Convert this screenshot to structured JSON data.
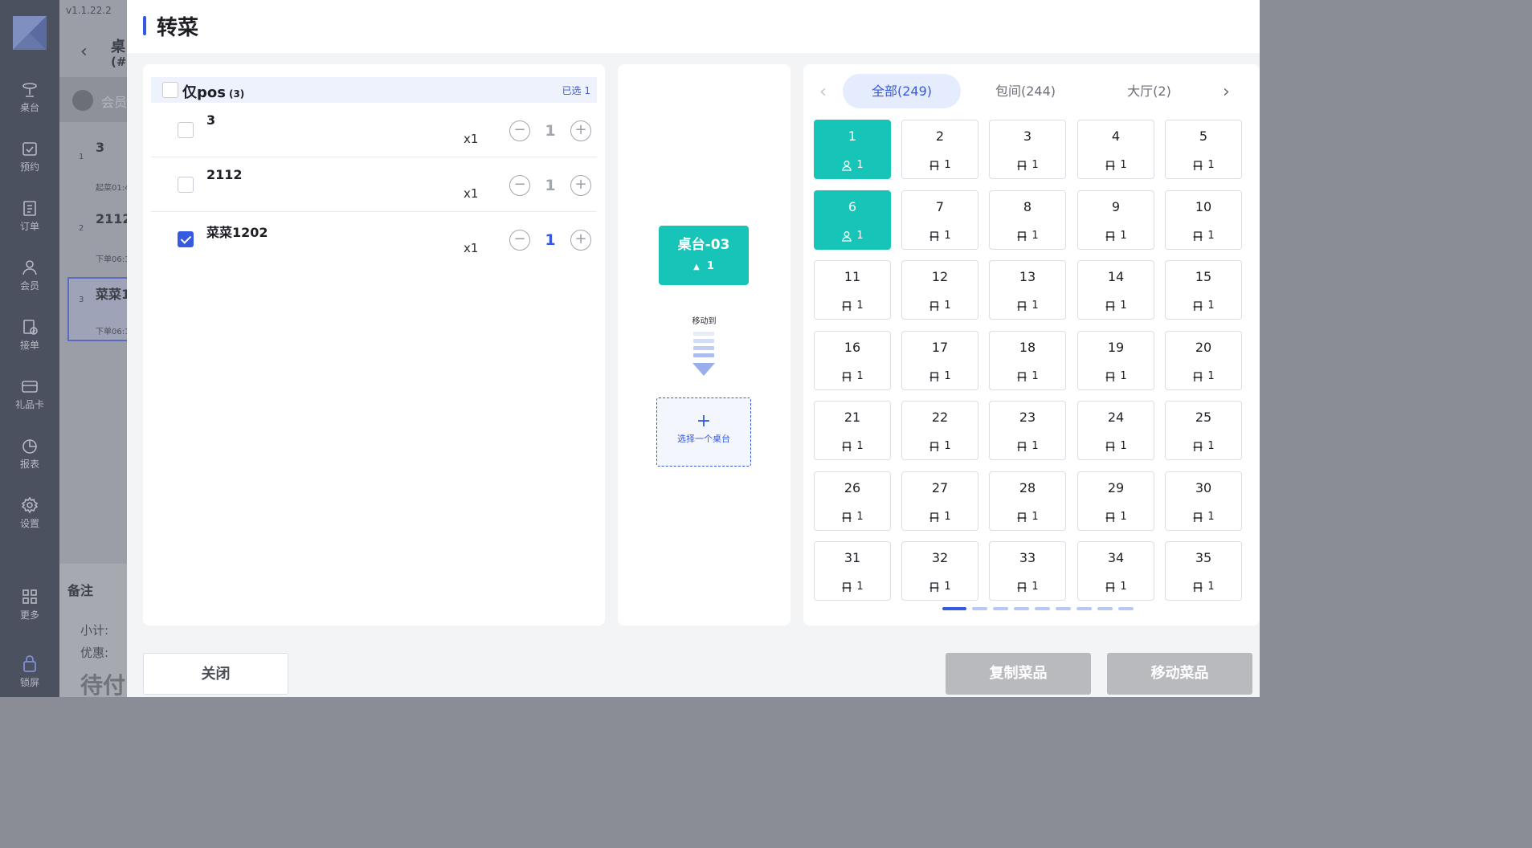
{
  "app": {
    "version": "v1.1.22.2",
    "sidebar": [
      {
        "icon": "table-icon",
        "label": "桌台"
      },
      {
        "icon": "booking-icon",
        "label": "预约"
      },
      {
        "icon": "order-icon",
        "label": "订单"
      },
      {
        "icon": "member-icon",
        "label": "会员"
      },
      {
        "icon": "receive-order-icon",
        "label": "接单"
      },
      {
        "icon": "gift-card-icon",
        "label": "礼品卡"
      },
      {
        "icon": "report-icon",
        "label": "报表"
      },
      {
        "icon": "settings-icon",
        "label": "设置"
      },
      {
        "icon": "more-icon",
        "label": "更多"
      },
      {
        "icon": "lock-icon",
        "label": "锁屏"
      }
    ],
    "background": {
      "header_title": "桌",
      "header_sub": "(#",
      "search_placeholder": "会员",
      "items": [
        {
          "num": "1",
          "name": "3",
          "time": "起菜01:4"
        },
        {
          "num": "2",
          "name": "2112",
          "time": "下单06:1"
        },
        {
          "num": "3",
          "name": "菜菜1",
          "time": "下单06:1"
        }
      ],
      "remark_label": "备注",
      "subtotal_label": "小计:",
      "discount_label": "优惠:",
      "pending_label": "待付"
    }
  },
  "modal": {
    "title": "转菜",
    "group": {
      "name": "仅pos",
      "count": "(3)",
      "selected": "已选 1",
      "checked": false
    },
    "dishes": [
      {
        "name": "3",
        "qty": "x1",
        "value": "1",
        "checked": false
      },
      {
        "name": "2112",
        "qty": "x1",
        "value": "1",
        "checked": false
      },
      {
        "name": "菜菜1202",
        "qty": "x1",
        "value": "1",
        "checked": true
      }
    ],
    "source_table": {
      "name": "桌台-03",
      "count": "1"
    },
    "move_label": "移动到",
    "select_table": {
      "plus": "+",
      "text": "选择一个桌台"
    },
    "tabs": [
      {
        "label": "全部(249)",
        "active": true
      },
      {
        "label": "包间(244)",
        "active": false
      },
      {
        "label": "大厅(2)",
        "active": false
      }
    ],
    "tables": [
      {
        "num": "1",
        "seats": "1",
        "busy": true
      },
      {
        "num": "2",
        "seats": "1",
        "busy": false
      },
      {
        "num": "3",
        "seats": "1",
        "busy": false
      },
      {
        "num": "4",
        "seats": "1",
        "busy": false
      },
      {
        "num": "5",
        "seats": "1",
        "busy": false
      },
      {
        "num": "6",
        "seats": "1",
        "busy": true
      },
      {
        "num": "7",
        "seats": "1",
        "busy": false
      },
      {
        "num": "8",
        "seats": "1",
        "busy": false
      },
      {
        "num": "9",
        "seats": "1",
        "busy": false
      },
      {
        "num": "10",
        "seats": "1",
        "busy": false
      },
      {
        "num": "11",
        "seats": "1",
        "busy": false
      },
      {
        "num": "12",
        "seats": "1",
        "busy": false
      },
      {
        "num": "13",
        "seats": "1",
        "busy": false
      },
      {
        "num": "14",
        "seats": "1",
        "busy": false
      },
      {
        "num": "15",
        "seats": "1",
        "busy": false
      },
      {
        "num": "16",
        "seats": "1",
        "busy": false
      },
      {
        "num": "17",
        "seats": "1",
        "busy": false
      },
      {
        "num": "18",
        "seats": "1",
        "busy": false
      },
      {
        "num": "19",
        "seats": "1",
        "busy": false
      },
      {
        "num": "20",
        "seats": "1",
        "busy": false
      },
      {
        "num": "21",
        "seats": "1",
        "busy": false
      },
      {
        "num": "22",
        "seats": "1",
        "busy": false
      },
      {
        "num": "23",
        "seats": "1",
        "busy": false
      },
      {
        "num": "24",
        "seats": "1",
        "busy": false
      },
      {
        "num": "25",
        "seats": "1",
        "busy": false
      },
      {
        "num": "26",
        "seats": "1",
        "busy": false
      },
      {
        "num": "27",
        "seats": "1",
        "busy": false
      },
      {
        "num": "28",
        "seats": "1",
        "busy": false
      },
      {
        "num": "29",
        "seats": "1",
        "busy": false
      },
      {
        "num": "30",
        "seats": "1",
        "busy": false
      },
      {
        "num": "31",
        "seats": "1",
        "busy": false
      },
      {
        "num": "32",
        "seats": "1",
        "busy": false
      },
      {
        "num": "33",
        "seats": "1",
        "busy": false
      },
      {
        "num": "34",
        "seats": "1",
        "busy": false
      },
      {
        "num": "35",
        "seats": "1",
        "busy": false
      }
    ],
    "pager": {
      "pages": 9,
      "current": 1
    },
    "footer": {
      "close": "关闭",
      "copy": "复制菜品",
      "move": "移动菜品"
    },
    "colors": {
      "accent": "#3559e0",
      "busy": "#16c5b7",
      "disabled": "#b9babd"
    }
  }
}
